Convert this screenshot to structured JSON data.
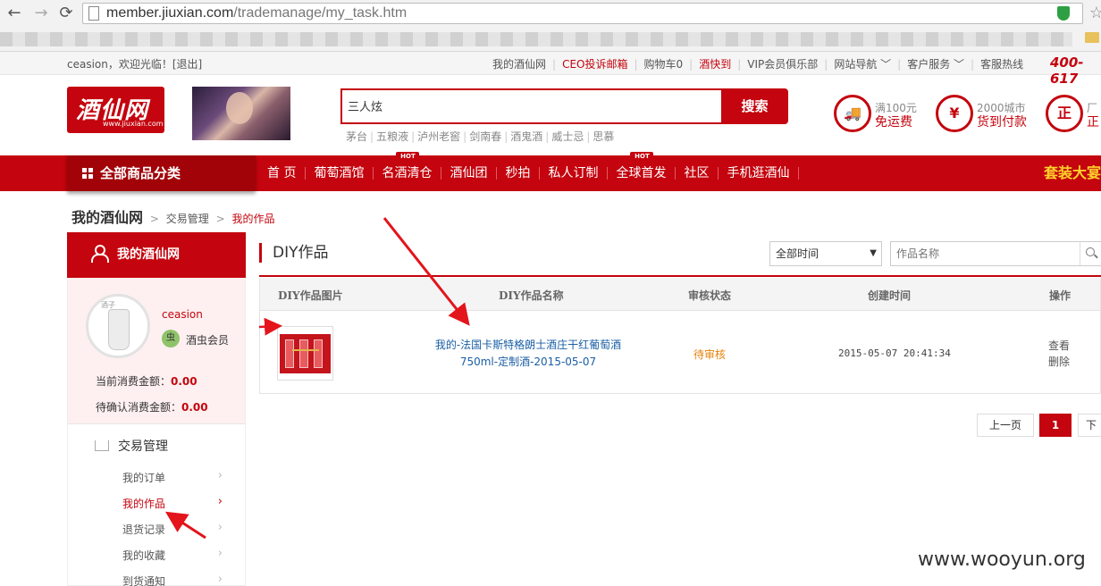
{
  "browser": {
    "url_host": "member.jiuxian.com",
    "url_path": "/trademanage/my_task.htm"
  },
  "topbar": {
    "greeting": "ceasion，欢迎光临！[退出]",
    "links": [
      {
        "label": "我的酒仙网",
        "red": false
      },
      {
        "label": "CEO投诉邮箱",
        "red": true
      },
      {
        "label": "购物车0",
        "red": false
      },
      {
        "label": "酒快到",
        "red": true
      },
      {
        "label": "VIP会员俱乐部",
        "red": false
      },
      {
        "label": "网站导航 ﹀",
        "red": false
      },
      {
        "label": "客户服务 ﹀",
        "red": false
      },
      {
        "label": "客服热线",
        "red": false
      }
    ],
    "hotline": "400-617"
  },
  "header": {
    "logo_cn": "酒仙网",
    "logo_en": "www.jiuxian.com",
    "search_value": "三人炫",
    "search_button": "搜索",
    "hotwords": [
      "茅台",
      "五粮液",
      "泸州老窖",
      "剑南春",
      "酒鬼酒",
      "威士忌",
      "思慕"
    ],
    "promos": [
      {
        "icon": "truck-icon",
        "glyph": "🚚",
        "line1": "满100元",
        "line2": "免运费"
      },
      {
        "icon": "cash-icon",
        "glyph": "¥",
        "line1": "2000城市",
        "line2": "货到付款"
      },
      {
        "icon": "genuine-icon",
        "glyph": "正",
        "line1": "厂",
        "line2": "正"
      }
    ]
  },
  "mainnav": {
    "all_categories": "全部商品分类",
    "items": [
      {
        "label": "首  页",
        "hot": false
      },
      {
        "label": "葡萄酒馆",
        "hot": false
      },
      {
        "label": "名酒清仓",
        "hot": true
      },
      {
        "label": "酒仙团",
        "hot": false
      },
      {
        "label": "秒拍",
        "hot": false
      },
      {
        "label": "私人订制",
        "hot": false
      },
      {
        "label": "全球首发",
        "hot": true
      },
      {
        "label": "社区",
        "hot": false
      },
      {
        "label": "手机逛酒仙",
        "hot": false
      }
    ],
    "hot_badge": "HOT",
    "promo_text": "套装大宴"
  },
  "breadcrumb": {
    "title": "我的酒仙网",
    "level1": "交易管理",
    "current": "我的作品"
  },
  "sidebar": {
    "heading": "我的酒仙网",
    "avatar_caption": "酒子",
    "username": "ceasion",
    "level_badge": "虫",
    "level": "酒虫会员",
    "stats": [
      {
        "label": "当前消费金额：",
        "value": "0.00"
      },
      {
        "label": "待确认消费金额：",
        "value": "0.00"
      }
    ],
    "menu_title": "交易管理",
    "menu_items": [
      {
        "label": "我的订单",
        "active": false
      },
      {
        "label": "我的作品",
        "active": true
      },
      {
        "label": "退货记录",
        "active": false
      },
      {
        "label": "我的收藏",
        "active": false
      },
      {
        "label": "到货通知",
        "active": false
      }
    ]
  },
  "content": {
    "title": "DIY作品",
    "time_filter": "全部时间",
    "name_placeholder": "作品名称",
    "columns": [
      "DIY作品图片",
      "DIY作品名称",
      "审核状态",
      "创建时间",
      "操作"
    ],
    "rows": [
      {
        "name": "我的-法国卡斯特格朗士酒庄干红葡萄酒750ml-定制酒-2015-05-07",
        "status": "待审核",
        "created": "2015-05-07 20:41:34",
        "actions": [
          "查看",
          "删除"
        ]
      }
    ],
    "pager": {
      "prev": "上一页",
      "current": "1",
      "next": "下"
    }
  },
  "watermark": "www.wooyun.org",
  "colors": {
    "brand": "#c4040e",
    "link": "#1a5fa5",
    "pending": "#e5820a"
  }
}
